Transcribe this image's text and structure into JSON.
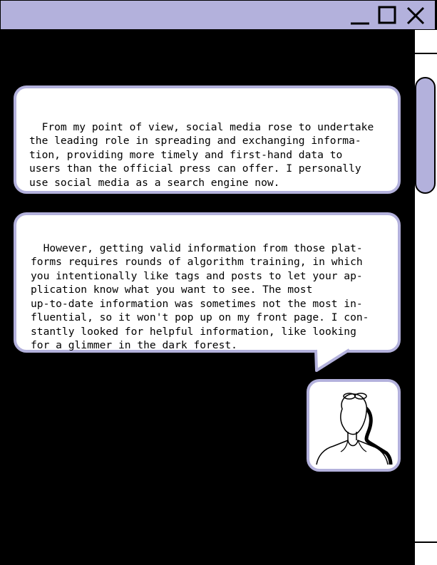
{
  "window": {
    "controls": [
      "minimize-icon",
      "maximize-icon",
      "close-icon"
    ],
    "accent_color": "#b3b1dc"
  },
  "messages": [
    {
      "text": "From my point of view, social media rose to undertake\nthe leading role in spreading and exchanging informa-\ntion, providing more timely and first-hand data to\nusers than the official press can offer. I personally\nuse social media as a search engine now."
    },
    {
      "text": "However, getting valid information from those plat-\nforms requires rounds of algorithm training, in which\nyou intentionally like tags and posts to let your ap-\nplication know what you want to see. The most\nup-to-date information was sometimes not the most in-\nfluential, so it won't pop up on my front page. I con-\nstantly looked for helpful information, like looking\nfor a glimmer in the dark forest."
    }
  ],
  "avatar": {
    "icon": "person-with-glasses-icon"
  }
}
